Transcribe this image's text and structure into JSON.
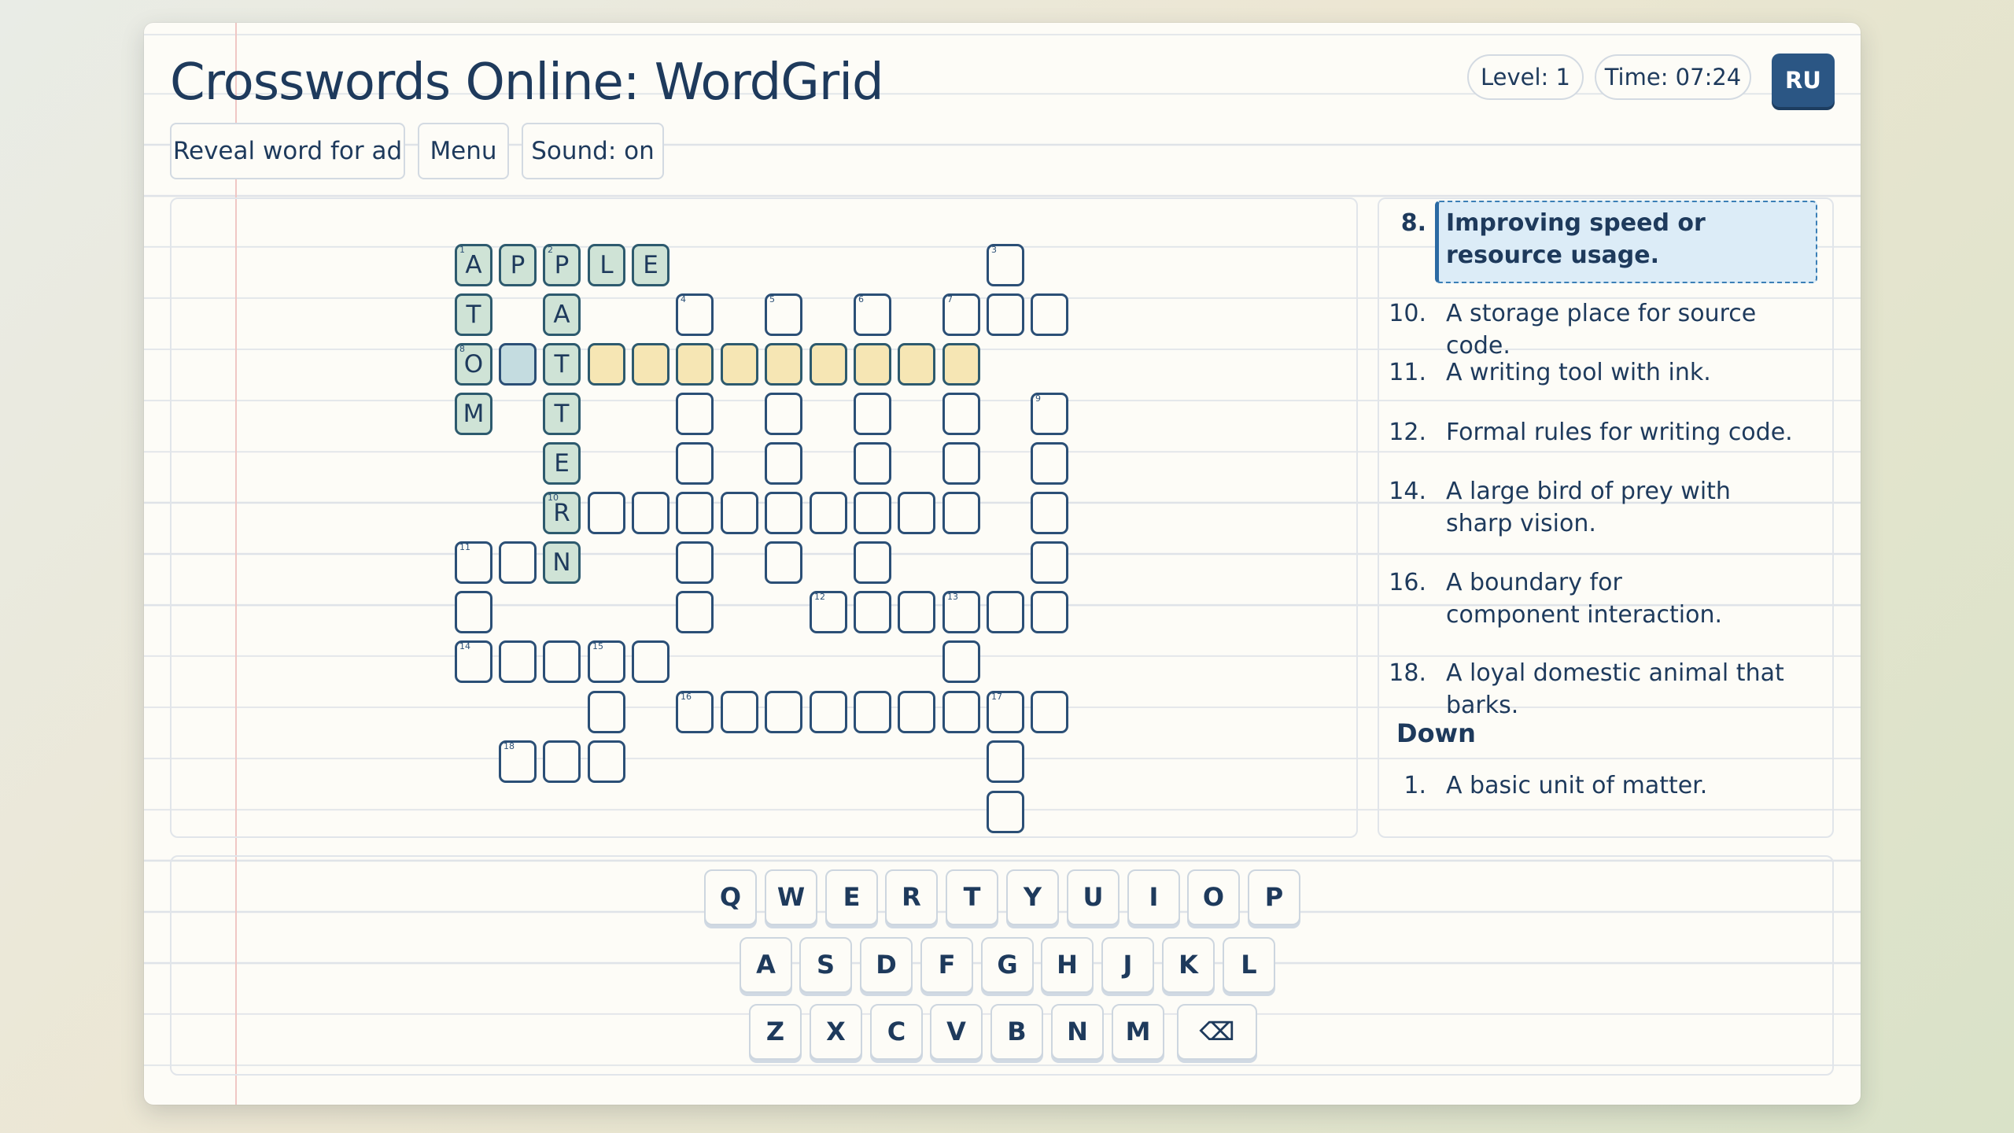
{
  "app": {
    "title": "Crosswords Online: WordGrid"
  },
  "status": {
    "level": "Level: 1",
    "time": "Time: 07:24",
    "language": "RU"
  },
  "toolbar": {
    "reveal_label": "Reveal word for ad",
    "menu_label": "Menu",
    "sound_label": "Sound: on"
  },
  "grid": {
    "numbers": {
      "n1": "1",
      "n2": "2",
      "n3": "3",
      "n4": "4",
      "n5": "5",
      "n6": "6",
      "n7": "7",
      "n8": "8",
      "n9": "9",
      "n10": "10",
      "n11": "11",
      "n12": "12",
      "n13": "13",
      "n14": "14",
      "n15": "15",
      "n16": "16",
      "n17": "17",
      "n18": "18"
    },
    "letters": {
      "a1": "A",
      "a2": "P",
      "a3": "P",
      "a4": "L",
      "a5": "E",
      "t1": "T",
      "o1": "O",
      "m1": "M",
      "p2": "A",
      "p3": "T",
      "p4": "T",
      "p5": "E",
      "p6": "R",
      "p7": "N"
    }
  },
  "clues": {
    "active": {
      "number": "8.",
      "text": "Improving speed or resource usage."
    },
    "across": [
      {
        "number": "10.",
        "text": "A storage place for source code."
      },
      {
        "number": "11.",
        "text": "A writing tool with ink."
      },
      {
        "number": "12.",
        "text": "Formal rules for writing code."
      },
      {
        "number": "14.",
        "text": "A large bird of prey with sharp vision."
      },
      {
        "number": "16.",
        "text": "A boundary for component interaction."
      },
      {
        "number": "18.",
        "text": "A loyal domestic animal that barks."
      }
    ],
    "down_heading": "Down",
    "down": [
      {
        "number": "1.",
        "text": "A basic unit of matter."
      }
    ]
  },
  "keyboard": {
    "row1": [
      "Q",
      "W",
      "E",
      "R",
      "T",
      "Y",
      "U",
      "I",
      "O",
      "P"
    ],
    "row2": [
      "A",
      "S",
      "D",
      "F",
      "G",
      "H",
      "J",
      "K",
      "L"
    ],
    "row3": [
      "Z",
      "X",
      "C",
      "V",
      "B",
      "N",
      "M"
    ],
    "backspace": "⌫"
  }
}
